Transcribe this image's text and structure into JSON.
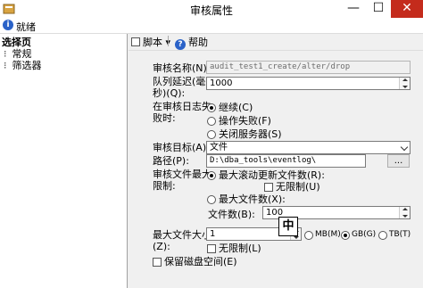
{
  "window": {
    "title": "审核属性",
    "minimize_glyph": "—",
    "maximize_glyph": "☐",
    "close_glyph": "✕"
  },
  "status": {
    "text": "就绪"
  },
  "left_pane": {
    "title": "选择页",
    "items": [
      {
        "label": "常规"
      },
      {
        "label": "筛选器"
      }
    ]
  },
  "toolbar": {
    "script_label": "脚本",
    "script_dropdown": "▾",
    "help_label": "帮助"
  },
  "form": {
    "audit_name_label": "审核名称(N):",
    "audit_name_value": "audit_test1_create/alter/drop",
    "queue_delay_label_1": "队列延迟(毫",
    "queue_delay_label_2": "秒)(Q):",
    "queue_delay_value": "1000",
    "on_log_failure_label_1": "在审核日志失",
    "on_log_failure_label_2": "败时:",
    "on_failure_options": [
      {
        "label": "继续(C)",
        "selected": true
      },
      {
        "label": "操作失败(F)",
        "selected": false
      },
      {
        "label": "关闭服务器(S)",
        "selected": false
      }
    ],
    "audit_target_label": "审核目标(A):",
    "audit_target_value": "文件",
    "path_label": "路径(P):",
    "path_value": "D:\\dba_tools\\eventlog\\",
    "browse_label": "...",
    "max_files_label_1": "审核文件最大",
    "max_files_label_2": "限制:",
    "max_rollover_label": "最大滚动更新文件数(R):",
    "unlimited_label_1": "无限制(U)",
    "max_files_option_label": "最大文件数(X):",
    "file_count_label": "文件数(B):",
    "file_count_value": "100",
    "max_file_size_label_1": "最大文件大小",
    "max_file_size_label_2": "(Z):",
    "max_file_size_value": "1",
    "ime_indicator": "中",
    "size_units": [
      {
        "label": "MB(M)",
        "selected": false
      },
      {
        "label": "GB(G)",
        "selected": true
      },
      {
        "label": "TB(T)",
        "selected": false
      }
    ],
    "unlimited_label_2": "无限制(L)",
    "reserve_disk_label": "保留磁盘空间(E)"
  }
}
